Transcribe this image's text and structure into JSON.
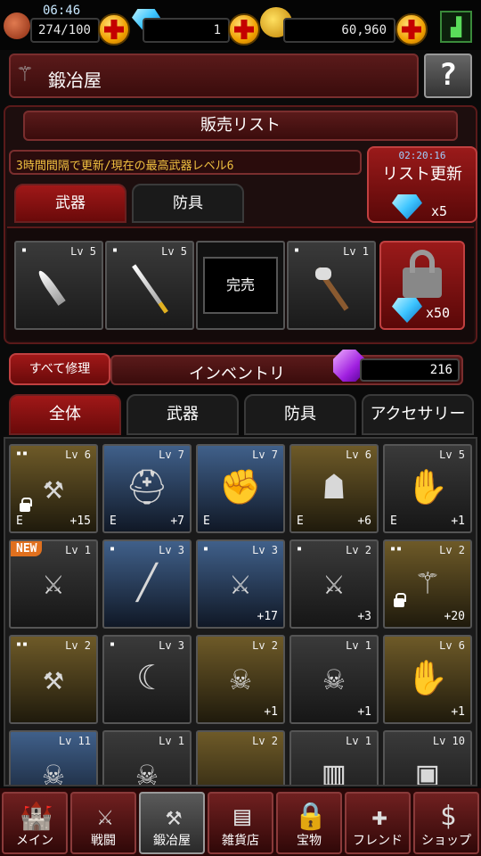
{
  "status": {
    "time": "06:46",
    "stamina": "274/100",
    "gems": "1",
    "gold": "60,960"
  },
  "header": {
    "title": "鍛冶屋",
    "help": "?"
  },
  "sale": {
    "title": "販売リスト",
    "notice": "3時間間隔で更新/現在の最高武器レベル6",
    "timer": "02:20:16",
    "refresh_label": "リスト更新",
    "refresh_cost": "x5",
    "tabs": [
      "武器",
      "防具"
    ],
    "items": [
      {
        "lv": "Lv 5",
        "dots": "▪",
        "icon": "dagger-icon"
      },
      {
        "lv": "Lv 5",
        "dots": "▪",
        "icon": "katana-icon"
      },
      {
        "soldout": "完売"
      },
      {
        "lv": "Lv 1",
        "dots": "▪",
        "icon": "axe-icon"
      }
    ],
    "unlock_cost": "x50"
  },
  "inventory": {
    "repair_label": "すべて修理",
    "title": "インベントリ",
    "count": "216",
    "tabs": [
      "全体",
      "武器",
      "防具",
      "アクセサリー"
    ]
  },
  "grid": [
    {
      "lv": "Lv 6",
      "dots": "▪▪",
      "bg": "gold",
      "e": "E",
      "plus": "+15",
      "lock": true,
      "icon": "battle-axe-icon"
    },
    {
      "lv": "Lv 7",
      "dots": "",
      "bg": "blue",
      "e": "E",
      "plus": "+7",
      "icon": "helmet-icon"
    },
    {
      "lv": "Lv 7",
      "dots": "",
      "bg": "blue",
      "e": "E",
      "plus": "",
      "icon": "gauntlets-icon"
    },
    {
      "lv": "Lv 6",
      "dots": "",
      "bg": "gold",
      "e": "E",
      "plus": "+6",
      "icon": "armor-icon"
    },
    {
      "lv": "Lv 5",
      "dots": "",
      "bg": "gray",
      "e": "E",
      "plus": "+1",
      "icon": "gloves-icon"
    },
    {
      "lv": "Lv 1",
      "dots": "",
      "bg": "gray",
      "e": "",
      "plus": "",
      "new": "NEW",
      "icon": "longsword-icon"
    },
    {
      "lv": "Lv 3",
      "dots": "▪",
      "bg": "blue",
      "e": "",
      "plus": "",
      "icon": "rapier-icon"
    },
    {
      "lv": "Lv 3",
      "dots": "▪",
      "bg": "blue",
      "e": "",
      "plus": "+17",
      "icon": "sword-icon"
    },
    {
      "lv": "Lv 2",
      "dots": "▪",
      "bg": "gray",
      "e": "",
      "plus": "+3",
      "icon": "sword-icon"
    },
    {
      "lv": "Lv 2",
      "dots": "▪▪",
      "bg": "gold",
      "e": "",
      "plus": "+20",
      "lock": true,
      "icon": "halberd-icon"
    },
    {
      "lv": "Lv 2",
      "dots": "▪▪",
      "bg": "gold",
      "e": "",
      "plus": "",
      "icon": "mace-icon"
    },
    {
      "lv": "Lv 3",
      "dots": "▪",
      "bg": "gray",
      "e": "",
      "plus": "",
      "icon": "scimitar-icon"
    },
    {
      "lv": "Lv 2",
      "dots": "",
      "bg": "gold",
      "e": "",
      "plus": "+1",
      "icon": "skull-helm-icon"
    },
    {
      "lv": "Lv 1",
      "dots": "",
      "bg": "gray",
      "e": "",
      "plus": "+1",
      "icon": "skull-helm-icon"
    },
    {
      "lv": "Lv 6",
      "dots": "",
      "bg": "gold",
      "e": "",
      "plus": "+1",
      "icon": "gloves-icon"
    },
    {
      "lv": "Lv 11",
      "dots": "",
      "bg": "blue",
      "e": "",
      "plus": "",
      "icon": "skull-necklace-icon"
    },
    {
      "lv": "Lv 1",
      "dots": "",
      "bg": "gray",
      "e": "",
      "plus": "",
      "icon": "skull-necklace-icon"
    },
    {
      "lv": "Lv 2",
      "dots": "",
      "bg": "gold",
      "e": "",
      "plus": "",
      "icon": "empty"
    },
    {
      "lv": "Lv 1",
      "dots": "",
      "bg": "gray",
      "e": "",
      "plus": "",
      "icon": "wooden-shield-icon"
    },
    {
      "lv": "Lv 10",
      "dots": "",
      "bg": "gray",
      "e": "",
      "plus": "",
      "icon": "iron-shield-icon"
    }
  ],
  "nav": [
    {
      "label": "メイン",
      "icon": "castle-icon"
    },
    {
      "label": "戦闘",
      "icon": "crossed-swords-icon"
    },
    {
      "label": "鍛冶屋",
      "icon": "anvil-icon"
    },
    {
      "label": "雑貨店",
      "icon": "chest-icon"
    },
    {
      "label": "宝物",
      "icon": "treasure-lock-icon"
    },
    {
      "label": "フレンド",
      "icon": "friend-add-icon"
    },
    {
      "label": "ショップ",
      "icon": "shop-icon"
    }
  ],
  "colors": {
    "accent": "#a01818",
    "gem": "#3ec5ff",
    "gold": "#f0a000"
  }
}
